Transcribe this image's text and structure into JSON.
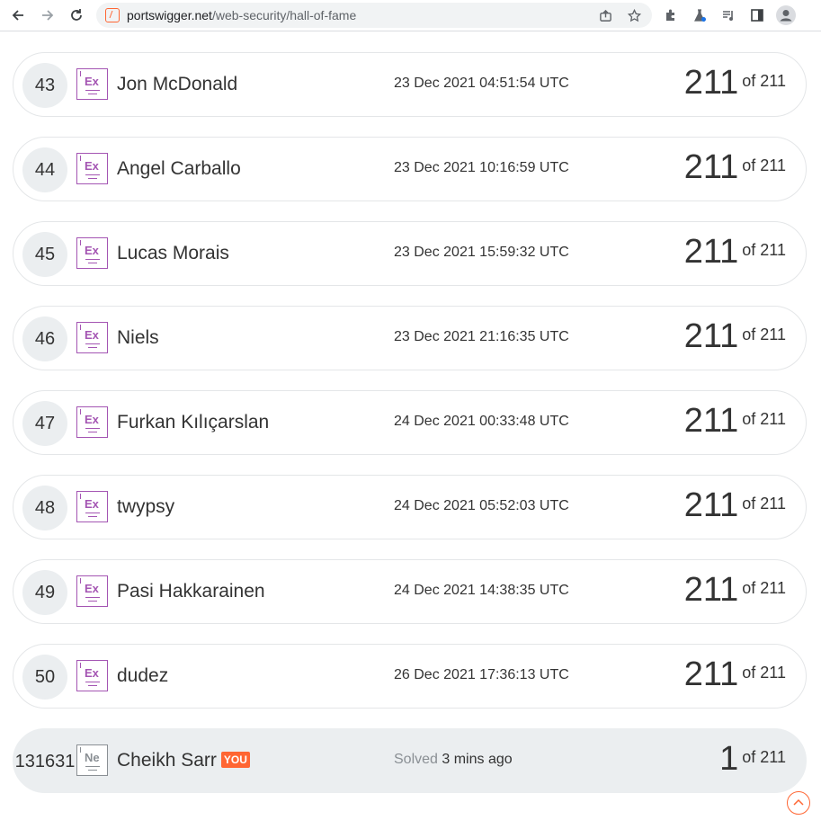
{
  "browser": {
    "url_domain": "portswigger.net",
    "url_path": "/web-security/hall-of-fame"
  },
  "rows": [
    {
      "rank": "43",
      "badge": "Ex",
      "name": "Jon McDonald",
      "date": "23 Dec 2021 04:51:54 UTC",
      "score": "211",
      "of": "of 211"
    },
    {
      "rank": "44",
      "badge": "Ex",
      "name": "Angel Carballo",
      "date": "23 Dec 2021 10:16:59 UTC",
      "score": "211",
      "of": "of 211"
    },
    {
      "rank": "45",
      "badge": "Ex",
      "name": "Lucas Morais",
      "date": "23 Dec 2021 15:59:32 UTC",
      "score": "211",
      "of": "of 211"
    },
    {
      "rank": "46",
      "badge": "Ex",
      "name": "Niels",
      "date": "23 Dec 2021 21:16:35 UTC",
      "score": "211",
      "of": "of 211"
    },
    {
      "rank": "47",
      "badge": "Ex",
      "name": "Furkan Kılıçarslan",
      "date": "24 Dec 2021 00:33:48 UTC",
      "score": "211",
      "of": "of 211"
    },
    {
      "rank": "48",
      "badge": "Ex",
      "name": "twypsy",
      "date": "24 Dec 2021 05:52:03 UTC",
      "score": "211",
      "of": "of 211"
    },
    {
      "rank": "49",
      "badge": "Ex",
      "name": "Pasi Hakkarainen",
      "date": "24 Dec 2021 14:38:35 UTC",
      "score": "211",
      "of": "of 211"
    },
    {
      "rank": "50",
      "badge": "Ex",
      "name": "dudez",
      "date": "26 Dec 2021 17:36:13 UTC",
      "score": "211",
      "of": "of 211"
    }
  ],
  "me": {
    "rank": "131631",
    "badge": "Ne",
    "name": "Cheikh Sarr",
    "you_label": "YOU",
    "solved_label": "Solved",
    "solved_time": "3 mins ago",
    "score": "1",
    "of": "of 211"
  },
  "colors": {
    "accent": "#ff6633",
    "badge_expert": "#a455b3",
    "badge_newbie": "#8a8f94",
    "row_highlight": "#ebeef0"
  }
}
